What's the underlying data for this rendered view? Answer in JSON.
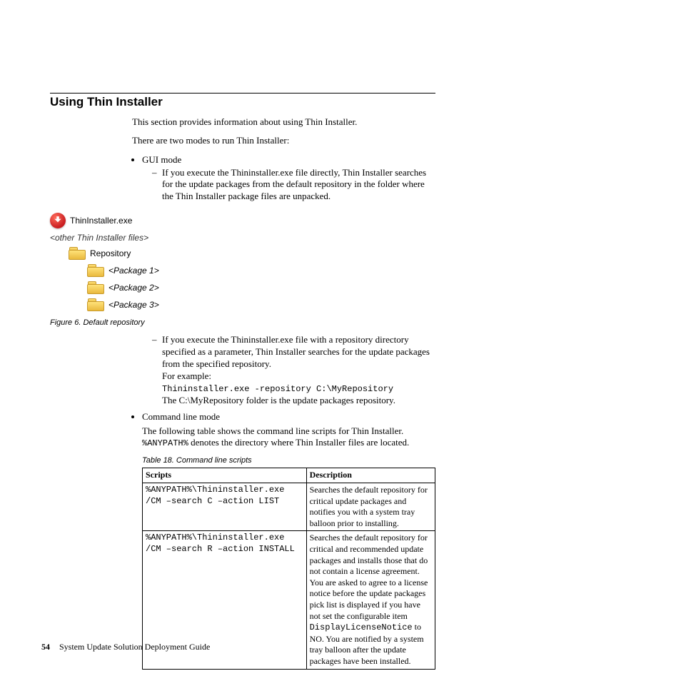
{
  "section_title": "Using Thin Installer",
  "intro_p1": "This section provides information about using Thin Installer.",
  "intro_p2": "There are two modes to run Thin Installer:",
  "bullet_gui": "GUI mode",
  "gui_dash1": "If you execute the Thininstaller.exe file directly, Thin Installer searches for the update packages from the default repository in the folder where the Thin Installer package files are unpacked.",
  "figure": {
    "exe_label": "ThinInstaller.exe",
    "other_files": "<other Thin Installer files>",
    "repo_label": "Repository",
    "pkg1": "<Package 1>",
    "pkg2": "<Package 2>",
    "pkg3": "<Package 3>",
    "caption": "Figure 6. Default repository"
  },
  "gui_dash2_p1": "If you execute the Thininstaller.exe file with a repository directory specified as a parameter, Thin Installer searches for the update packages from the specified repository.",
  "gui_dash2_example_label": "For example:",
  "gui_dash2_cmd": "Thininstaller.exe -repository C:\\MyRepository",
  "gui_dash2_p2": "The C:\\MyRepository folder is the update packages repository.",
  "bullet_cmd": "Command line mode",
  "cmd_p1_a": "The following table shows the command line scripts for Thin Installer. ",
  "cmd_anypath": "%ANYPATH%",
  "cmd_p1_b": " denotes the directory where Thin Installer files are located.",
  "table_caption": "Table 18. Command line scripts",
  "table": {
    "h1": "Scripts",
    "h2": "Description",
    "r1_script": "%ANYPATH%\\Thininstaller.exe /CM –search C –action LIST",
    "r1_desc": "Searches the default repository for critical update packages and notifies you with a system tray balloon prior to installing.",
    "r2_script": "%ANYPATH%\\Thininstaller.exe /CM –search R –action INSTALL",
    "r2_desc_a": "Searches the default repository for critical and recommended update packages and installs those that do not contain a license agreement. You are asked to agree to a license notice before the update packages pick list is displayed if you have not set the configurable item ",
    "r2_code": "DisplayLicenseNotice",
    "r2_desc_b": " to NO. You are notified by a system tray balloon after the update packages have been installed."
  },
  "footer": {
    "page": "54",
    "doc": "System Update Solution Deployment Guide"
  }
}
